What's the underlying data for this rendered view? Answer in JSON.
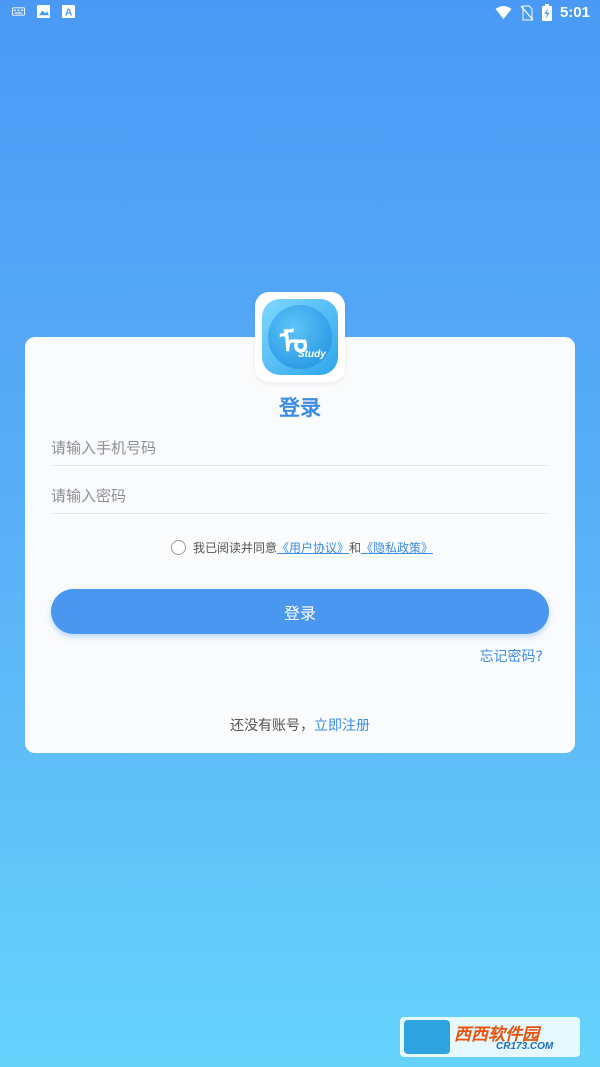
{
  "status_bar": {
    "time": "5:01",
    "left_icons": [
      "keyboard-icon",
      "image-icon",
      "font-icon"
    ],
    "right_icons": [
      "wifi-icon",
      "no-sim-icon",
      "battery-charging-icon"
    ]
  },
  "logo": {
    "glyph": "ᠮᠣ",
    "caption": "Study"
  },
  "login": {
    "title": "登录",
    "phone_placeholder": "请输入手机号码",
    "password_placeholder": "请输入密码",
    "agreement_prefix": "我已阅读并同意",
    "user_agreement": "《用户协议》",
    "and": "和",
    "privacy_policy": "《隐私政策》",
    "button_label": "登录",
    "forgot_password": "忘记密码?",
    "no_account": "还没有账号，",
    "register_now": "立即注册"
  },
  "watermark": {
    "name": "西西软件园",
    "domain": "CR173.COM"
  },
  "colors": {
    "accent": "#3d8de4",
    "button": "#4a97f0",
    "bg_top": "#4a9af5",
    "bg_bottom": "#66d3fb"
  }
}
